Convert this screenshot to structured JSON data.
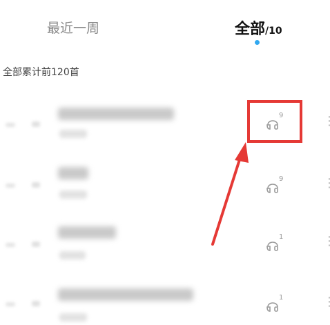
{
  "tabs": {
    "recent_label": "最近一周",
    "all_label": "全部",
    "all_count": "/10"
  },
  "summary": {
    "text": "全部累计前120首"
  },
  "songs": [
    {
      "title": "",
      "plays": "9"
    },
    {
      "title": "",
      "plays": "9"
    },
    {
      "title": "",
      "plays": "1"
    },
    {
      "title": "",
      "plays": "1"
    }
  ],
  "colors": {
    "accent_dot": "#31a8f0",
    "highlight": "#e53935"
  },
  "icons": {
    "plays": "headphones-icon",
    "more": "more-vertical-icon"
  }
}
